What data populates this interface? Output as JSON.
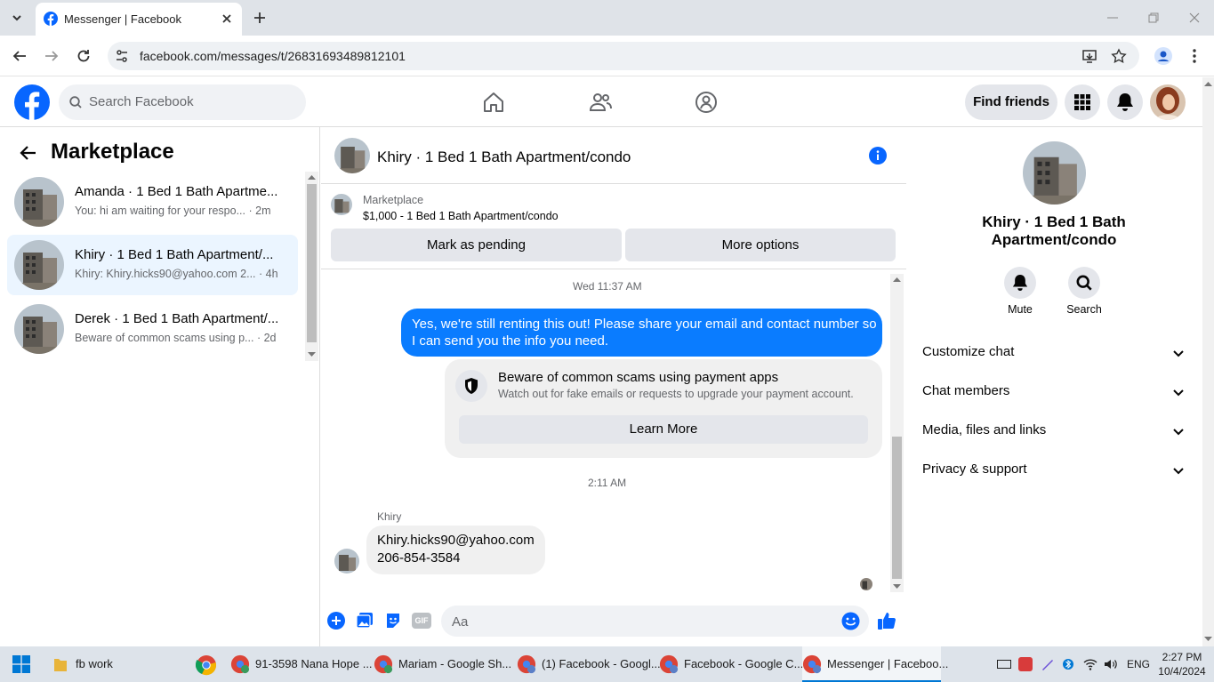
{
  "browser": {
    "tab_title": "Messenger | Facebook",
    "url": "facebook.com/messages/t/26831693489812101"
  },
  "header": {
    "search_placeholder": "Search Facebook",
    "find_friends": "Find friends"
  },
  "left_panel": {
    "title": "Marketplace",
    "conversations": [
      {
        "name": "Amanda · 1 Bed 1 Bath Apartme...",
        "preview": "You: hi am waiting for your respo...",
        "time": "· 2m"
      },
      {
        "name": "Khiry · 1 Bed 1 Bath Apartment/...",
        "preview": "Khiry: Khiry.hicks90@yahoo.com 2...",
        "time": "· 4h"
      },
      {
        "name": "Derek · 1 Bed 1 Bath Apartment/...",
        "preview": "Beware of common scams using p...",
        "time": "· 2d"
      }
    ]
  },
  "chat": {
    "title": "Khiry · 1 Bed 1 Bath Apartment/condo",
    "marketplace_label": "Marketplace",
    "listing": "$1,000 - 1 Bed 1 Bath Apartment/condo",
    "mark_pending": "Mark as pending",
    "more_options": "More options",
    "timestamp1": "Wed 11:37 AM",
    "outgoing_line1": "Yes, we're still renting this out! Please share your email and contact number so",
    "outgoing_line2": "I can send you the info you need.",
    "scam_title": "Beware of common scams using payment apps",
    "scam_text": "Watch out for fake emails or requests to upgrade your payment account.",
    "learn_more": "Learn More",
    "timestamp2": "2:11 AM",
    "sender": "Khiry",
    "incoming_line1": "Khiry.hicks90@yahoo.com",
    "incoming_line2": "206-854-3584",
    "composer_placeholder": "Aa",
    "gif_label": "GIF"
  },
  "right_panel": {
    "name_line1": "Khiry · 1 Bed 1 Bath",
    "name_line2": "Apartment/condo",
    "mute": "Mute",
    "search": "Search",
    "sections": [
      "Customize chat",
      "Chat members",
      "Media, files and links",
      "Privacy & support"
    ]
  },
  "taskbar": {
    "items": [
      "fb work",
      "91-3598 Nana Hope ...",
      "Mariam - Google Sh...",
      "(1) Facebook - Googl...",
      "Facebook - Google C...",
      "Messenger | Faceboo..."
    ],
    "lang": "ENG",
    "time": "2:27 PM",
    "date": "10/4/2024"
  },
  "colors": {
    "fb_blue": "#0866ff",
    "bubble_blue": "#0a7cff",
    "selected_row": "#ebf5ff"
  }
}
